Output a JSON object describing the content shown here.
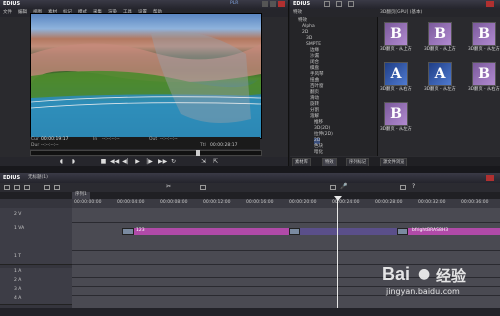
{
  "player": {
    "app_name": "EDIUS",
    "file_info": "PLR",
    "menu": [
      "文件",
      "编辑",
      "视图",
      "素材",
      "标记",
      "模式",
      "采集",
      "渲染",
      "工具",
      "设置",
      "帮助"
    ],
    "tc_cur_label": "Cur",
    "tc_cur": "00:00:19:17",
    "tc_in_label": "In",
    "tc_in": "--:--:--:--",
    "tc_out_label": "Out",
    "tc_out": "--:--:--:--",
    "tc_dur_label": "Dur",
    "tc_dur": "--:--:--:--",
    "tc_ttl_label": "Ttl",
    "tc_ttl": "00:00:28:17"
  },
  "bin": {
    "title": "EDIUS",
    "tree_header": "特效",
    "tree_items": [
      "特效",
      "Alpha",
      "2D",
      "3D",
      "SMPTE",
      "边缘",
      "沙漏",
      "闭合",
      "棋盘",
      "手风琴",
      "扭曲",
      "百叶窗",
      "翻页",
      "滑动",
      "旋转",
      "分割",
      "溶解",
      "推移",
      "3D(2D)",
      "拉伸(2D)",
      "2D",
      "色块",
      "暗化",
      "渐变",
      "圆形"
    ],
    "effects_header": "3D翻页[GPU] (基本)",
    "effects": [
      {
        "glyph": "B",
        "label": "3D翻页 - 从上方"
      },
      {
        "glyph": "B",
        "label": "3D翻页 - 从上方"
      },
      {
        "glyph": "B",
        "label": "3D翻页 - 从左方"
      },
      {
        "glyph": "A",
        "label": "3D翻页 - 从右方"
      },
      {
        "glyph": "A",
        "label": "3D翻页 - 从左方"
      },
      {
        "glyph": "B",
        "label": "3D翻页 - 从右方"
      },
      {
        "glyph": "B",
        "label": "3D翻页 - 从左方"
      }
    ],
    "tabs": [
      "素材库",
      "特效",
      "序列标记",
      "源文件浏览"
    ]
  },
  "timeline": {
    "app_name": "EDIUS",
    "project": "无标题(1)",
    "sequence_tab": "序列1",
    "ruler": [
      "00:00:00:00",
      "00:00:04:00",
      "00:00:08:00",
      "00:00:12:00",
      "00:00:16:00",
      "00:00:20:00",
      "00:00:24:00",
      "00:00:28:00",
      "00:00:32:00",
      "00:00:36:00"
    ],
    "tracks": [
      "2 V",
      "1 VA",
      "1 T",
      "1 A",
      "2 A",
      "3 A",
      "4 A"
    ],
    "clip_1": "123",
    "clip_2": "bfrightBRAS8H3"
  },
  "watermark": {
    "brand": "Bai",
    "brand2": "经验",
    "url": "jingyan.baidu.com"
  }
}
